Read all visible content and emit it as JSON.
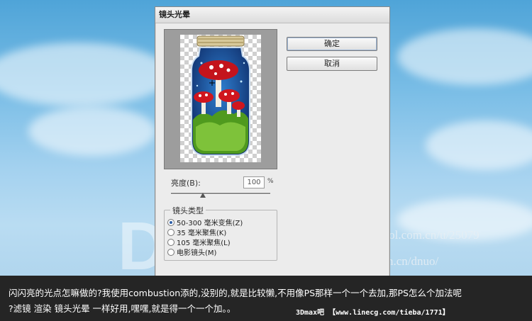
{
  "dialog": {
    "title": "镜头光晕",
    "ok_label": "确定",
    "cancel_label": "取消",
    "brightness_label": "亮度(B):",
    "brightness_value": "100",
    "brightness_unit": "%",
    "lens_group_label": "镜头类型",
    "lens_options": [
      {
        "label": "50-300 毫米变焦(Z)",
        "selected": true
      },
      {
        "label": "35 毫米聚焦(K)",
        "selected": false
      },
      {
        "label": "105 毫米聚焦(L)",
        "selected": false
      },
      {
        "label": "电影镜头(M)",
        "selected": false
      }
    ]
  },
  "watermark": {
    "letters": "DNUO",
    "url1": "http://www.zcool.com.cn/u/25079",
    "url2": "http://t.sina.com.cn/dnuo/"
  },
  "caption": {
    "line1": "闪闪亮的光点怎嘛做的?我使用combustion添的,没别的,就是比较懒,不用像PS那样一个一个去加,那PS怎么个加法呢",
    "line2": "?滤镜 渲染 镜头光晕 一样好用,嘿嘿,就是得一个一个加。。",
    "credit": "3Dmax吧 【www.linecg.com/tieba/1771】"
  },
  "colors": {
    "sky_top": "#4fa4d8",
    "sky_bottom": "#b9dcf2",
    "caption_bg": "#252525",
    "dialog_bg": "#ececec"
  }
}
